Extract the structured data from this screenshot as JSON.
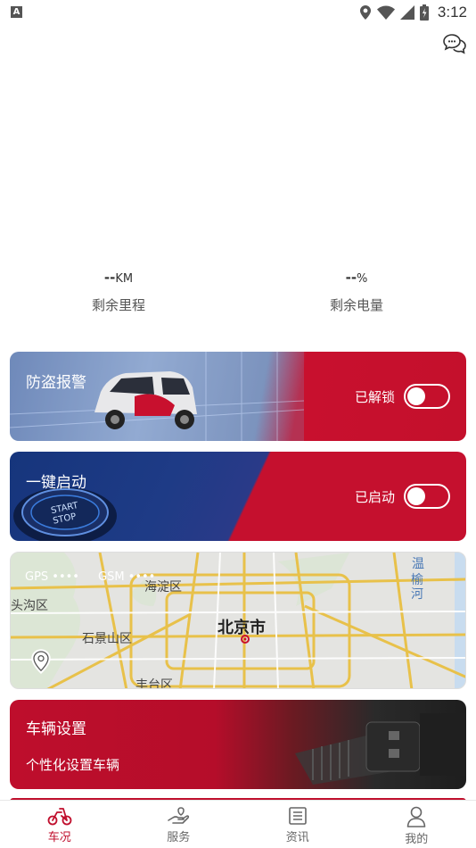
{
  "status_bar": {
    "time": "3:12",
    "indicator": "A"
  },
  "stats": [
    {
      "value": "--",
      "unit": "KM",
      "label": "剩余里程"
    },
    {
      "value": "--",
      "unit": "%",
      "label": "剩余电量"
    }
  ],
  "cards": {
    "alarm": {
      "title": "防盗报警",
      "state": "已解锁",
      "on": false
    },
    "start": {
      "title": "一键启动",
      "state": "已启动",
      "on": false,
      "button_text_1": "START",
      "button_text_2": "STOP"
    },
    "map": {
      "gps_label": "GPS",
      "gsm_label": "GSM",
      "places": [
        "海淀区",
        "北京市",
        "石景山区",
        "丰台区",
        "头沟区",
        "温",
        "榆",
        "河"
      ]
    },
    "settings": {
      "title": "车辆设置",
      "subtitle": "个性化设置车辆"
    }
  },
  "nav": [
    {
      "label": "车况",
      "icon": "scooter-icon",
      "active": true
    },
    {
      "label": "服务",
      "icon": "service-hand-icon",
      "active": false
    },
    {
      "label": "资讯",
      "icon": "news-icon",
      "active": false
    },
    {
      "label": "我的",
      "icon": "profile-icon",
      "active": false
    }
  ],
  "colors": {
    "accent": "#c00f2d",
    "navy": "#16357c"
  }
}
